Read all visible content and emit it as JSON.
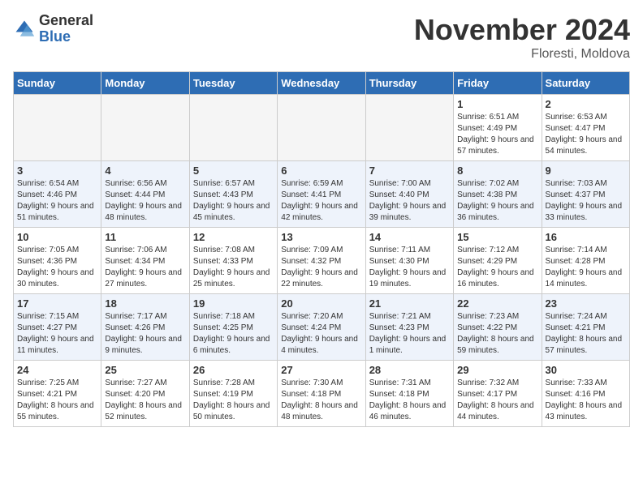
{
  "header": {
    "logo_general": "General",
    "logo_blue": "Blue",
    "month_title": "November 2024",
    "location": "Floresti, Moldova"
  },
  "weekdays": [
    "Sunday",
    "Monday",
    "Tuesday",
    "Wednesday",
    "Thursday",
    "Friday",
    "Saturday"
  ],
  "weeks": [
    [
      {
        "day": "",
        "info": ""
      },
      {
        "day": "",
        "info": ""
      },
      {
        "day": "",
        "info": ""
      },
      {
        "day": "",
        "info": ""
      },
      {
        "day": "",
        "info": ""
      },
      {
        "day": "1",
        "info": "Sunrise: 6:51 AM\nSunset: 4:49 PM\nDaylight: 9 hours and 57 minutes."
      },
      {
        "day": "2",
        "info": "Sunrise: 6:53 AM\nSunset: 4:47 PM\nDaylight: 9 hours and 54 minutes."
      }
    ],
    [
      {
        "day": "3",
        "info": "Sunrise: 6:54 AM\nSunset: 4:46 PM\nDaylight: 9 hours and 51 minutes."
      },
      {
        "day": "4",
        "info": "Sunrise: 6:56 AM\nSunset: 4:44 PM\nDaylight: 9 hours and 48 minutes."
      },
      {
        "day": "5",
        "info": "Sunrise: 6:57 AM\nSunset: 4:43 PM\nDaylight: 9 hours and 45 minutes."
      },
      {
        "day": "6",
        "info": "Sunrise: 6:59 AM\nSunset: 4:41 PM\nDaylight: 9 hours and 42 minutes."
      },
      {
        "day": "7",
        "info": "Sunrise: 7:00 AM\nSunset: 4:40 PM\nDaylight: 9 hours and 39 minutes."
      },
      {
        "day": "8",
        "info": "Sunrise: 7:02 AM\nSunset: 4:38 PM\nDaylight: 9 hours and 36 minutes."
      },
      {
        "day": "9",
        "info": "Sunrise: 7:03 AM\nSunset: 4:37 PM\nDaylight: 9 hours and 33 minutes."
      }
    ],
    [
      {
        "day": "10",
        "info": "Sunrise: 7:05 AM\nSunset: 4:36 PM\nDaylight: 9 hours and 30 minutes."
      },
      {
        "day": "11",
        "info": "Sunrise: 7:06 AM\nSunset: 4:34 PM\nDaylight: 9 hours and 27 minutes."
      },
      {
        "day": "12",
        "info": "Sunrise: 7:08 AM\nSunset: 4:33 PM\nDaylight: 9 hours and 25 minutes."
      },
      {
        "day": "13",
        "info": "Sunrise: 7:09 AM\nSunset: 4:32 PM\nDaylight: 9 hours and 22 minutes."
      },
      {
        "day": "14",
        "info": "Sunrise: 7:11 AM\nSunset: 4:30 PM\nDaylight: 9 hours and 19 minutes."
      },
      {
        "day": "15",
        "info": "Sunrise: 7:12 AM\nSunset: 4:29 PM\nDaylight: 9 hours and 16 minutes."
      },
      {
        "day": "16",
        "info": "Sunrise: 7:14 AM\nSunset: 4:28 PM\nDaylight: 9 hours and 14 minutes."
      }
    ],
    [
      {
        "day": "17",
        "info": "Sunrise: 7:15 AM\nSunset: 4:27 PM\nDaylight: 9 hours and 11 minutes."
      },
      {
        "day": "18",
        "info": "Sunrise: 7:17 AM\nSunset: 4:26 PM\nDaylight: 9 hours and 9 minutes."
      },
      {
        "day": "19",
        "info": "Sunrise: 7:18 AM\nSunset: 4:25 PM\nDaylight: 9 hours and 6 minutes."
      },
      {
        "day": "20",
        "info": "Sunrise: 7:20 AM\nSunset: 4:24 PM\nDaylight: 9 hours and 4 minutes."
      },
      {
        "day": "21",
        "info": "Sunrise: 7:21 AM\nSunset: 4:23 PM\nDaylight: 9 hours and 1 minute."
      },
      {
        "day": "22",
        "info": "Sunrise: 7:23 AM\nSunset: 4:22 PM\nDaylight: 8 hours and 59 minutes."
      },
      {
        "day": "23",
        "info": "Sunrise: 7:24 AM\nSunset: 4:21 PM\nDaylight: 8 hours and 57 minutes."
      }
    ],
    [
      {
        "day": "24",
        "info": "Sunrise: 7:25 AM\nSunset: 4:21 PM\nDaylight: 8 hours and 55 minutes."
      },
      {
        "day": "25",
        "info": "Sunrise: 7:27 AM\nSunset: 4:20 PM\nDaylight: 8 hours and 52 minutes."
      },
      {
        "day": "26",
        "info": "Sunrise: 7:28 AM\nSunset: 4:19 PM\nDaylight: 8 hours and 50 minutes."
      },
      {
        "day": "27",
        "info": "Sunrise: 7:30 AM\nSunset: 4:18 PM\nDaylight: 8 hours and 48 minutes."
      },
      {
        "day": "28",
        "info": "Sunrise: 7:31 AM\nSunset: 4:18 PM\nDaylight: 8 hours and 46 minutes."
      },
      {
        "day": "29",
        "info": "Sunrise: 7:32 AM\nSunset: 4:17 PM\nDaylight: 8 hours and 44 minutes."
      },
      {
        "day": "30",
        "info": "Sunrise: 7:33 AM\nSunset: 4:16 PM\nDaylight: 8 hours and 43 minutes."
      }
    ]
  ]
}
